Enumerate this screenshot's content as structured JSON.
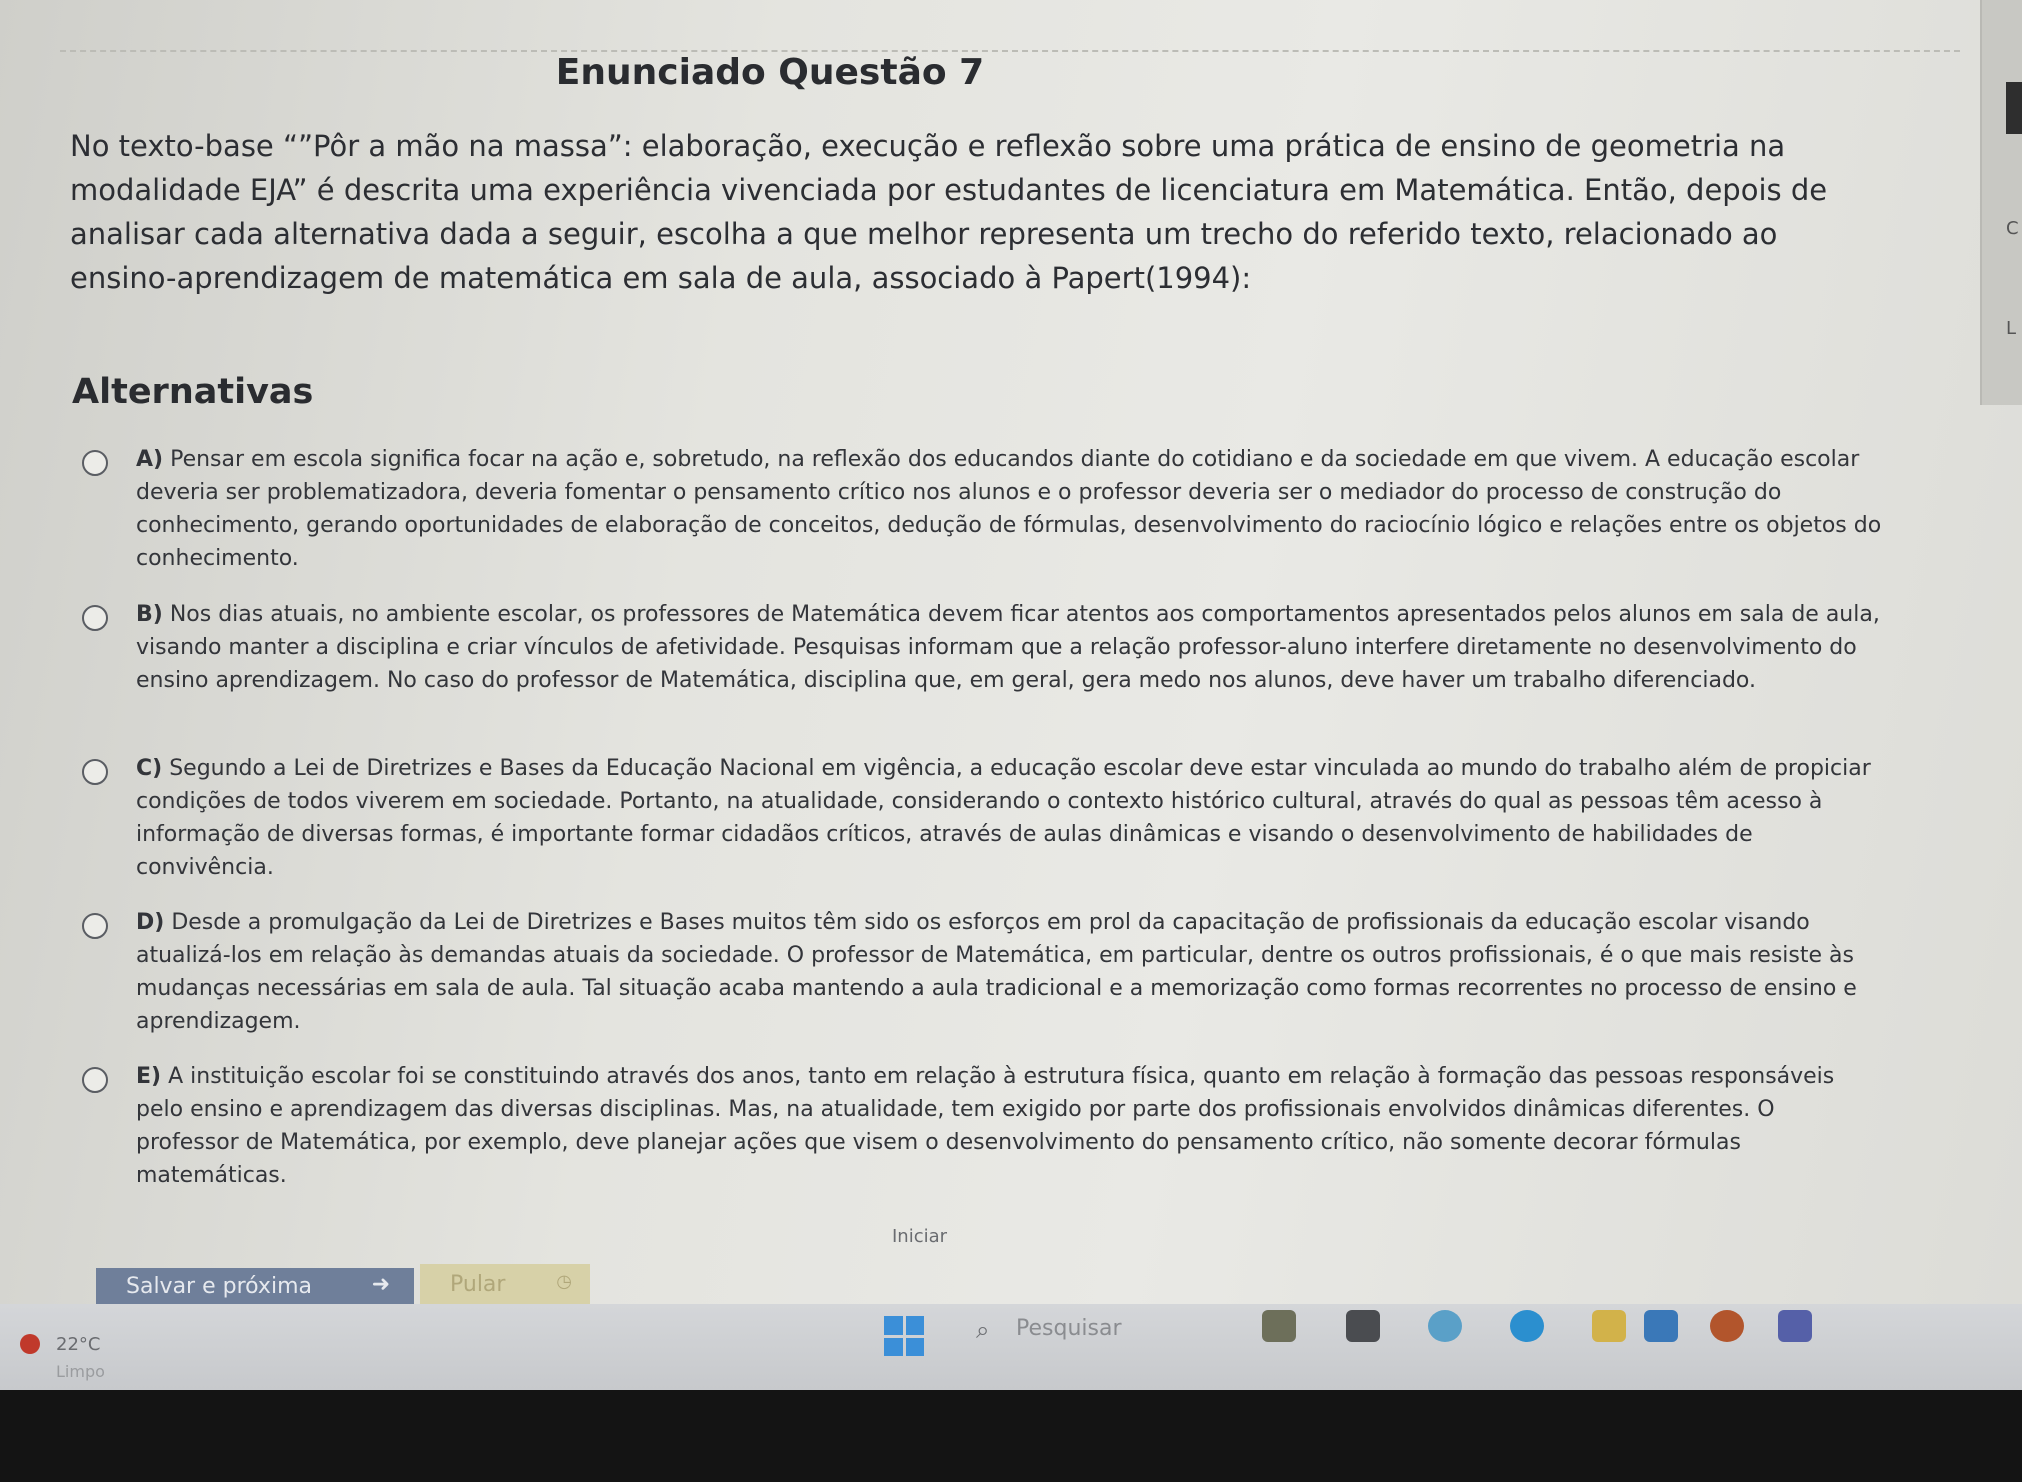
{
  "question": {
    "title": "Enunciado Questão 7",
    "statement": "No texto-base “”Pôr a mão na massa”: elaboração, execução e reflexão sobre uma prática de ensino de geometria na modalidade EJA” é descrita uma experiência vivenciada por estudantes de licenciatura em Matemática. Então, depois de analisar cada alternativa dada a seguir, escolha a que melhor representa um trecho do referido texto, relacionado ao ensino-aprendizagem de matemática em sala de aula, associado à Papert(1994):"
  },
  "alternatives": {
    "heading": "Alternativas",
    "items": [
      {
        "letter": "A)",
        "text": "Pensar em escola significa focar na ação e, sobretudo, na reflexão dos educandos diante do cotidiano e da sociedade em que vivem. A educação escolar deveria ser problematizadora, deveria fomentar o pensamento crítico nos alunos e o professor deveria ser o mediador do processo de construção do conhecimento, gerando oportunidades de elaboração de conceitos, dedução de fórmulas, desenvolvimento do raciocínio lógico e relações entre os objetos do conhecimento."
      },
      {
        "letter": "B)",
        "text": "Nos dias atuais, no ambiente escolar, os professores de Matemática devem ficar atentos aos comportamentos apresentados pelos alunos em sala de aula, visando manter a disciplina e criar vínculos de afetividade. Pesquisas informam que a relação professor-aluno interfere diretamente no desenvolvimento do ensino aprendizagem. No caso do professor de Matemática, disciplina que, em geral, gera medo nos alunos, deve haver um trabalho diferenciado."
      },
      {
        "letter": "C)",
        "text": "Segundo a Lei de Diretrizes e Bases da Educação Nacional em vigência, a educação escolar deve estar vinculada ao mundo do trabalho além de propiciar condições de todos viverem em sociedade. Portanto, na atualidade, considerando o contexto histórico cultural, através do qual as pessoas têm acesso à informação de diversas formas, é importante formar cidadãos críticos, através de aulas dinâmicas e visando o desenvolvimento de habilidades de convivência."
      },
      {
        "letter": "D)",
        "text": "Desde a promulgação da Lei de Diretrizes e Bases muitos têm sido os esforços em prol da capacitação de profissionais da educação escolar visando atualizá-los em relação às demandas atuais da sociedade. O professor de Matemática, em particular, dentre os outros profissionais, é o que mais resiste às mudanças necessárias em sala de aula. Tal situação acaba mantendo a aula tradicional e a memorização como formas recorrentes no processo de ensino e aprendizagem."
      },
      {
        "letter": "E)",
        "text": "A instituição escolar foi se constituindo através dos anos, tanto em relação à estrutura física, quanto em relação à formação das pessoas responsáveis pelo ensino e aprendizagem das diversas disciplinas. Mas, na atualidade, tem exigido por parte dos profissionais envolvidos dinâmicas diferentes. O professor de Matemática, por exemplo, deve planejar ações que visem o desenvolvimento do pensamento crítico, não somente decorar fórmulas matemáticas."
      }
    ]
  },
  "actions": {
    "iniciar": "Iniciar",
    "save_next": "Salvar e próxima",
    "skip": "Pular"
  },
  "edge": {
    "char1": "C",
    "char2": "L"
  },
  "taskbar": {
    "temperature": "22°C",
    "condition": "Limpo",
    "search_label": "Pesquisar",
    "colors": {
      "accent": "#3b8fd8",
      "save_button": "#6f7f9a",
      "skip_button": "#d7d1a8"
    }
  }
}
